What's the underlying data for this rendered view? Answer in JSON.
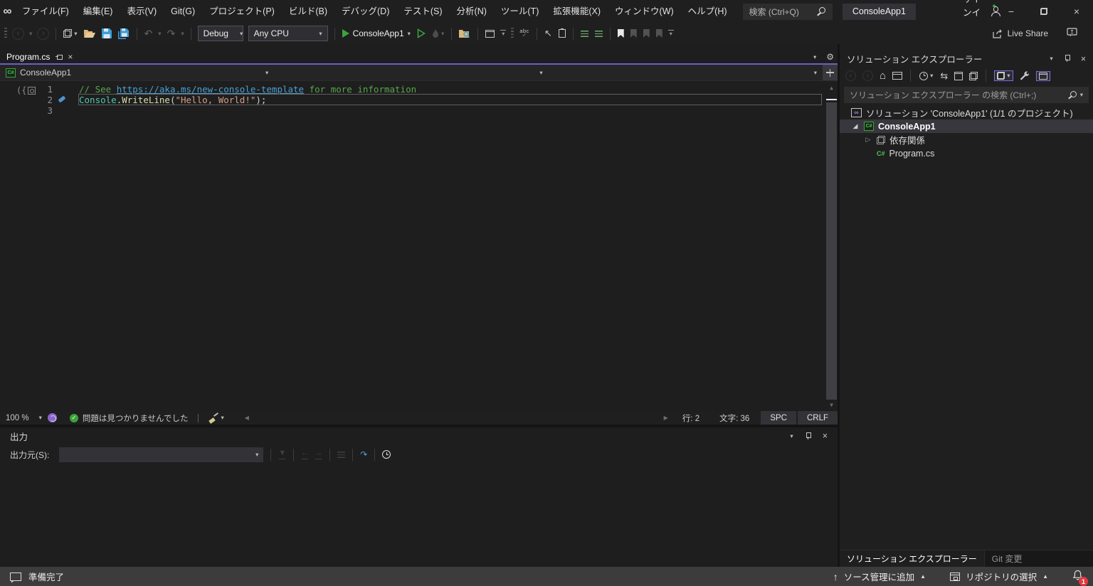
{
  "titlebar": {
    "menus": [
      "ファイル(F)",
      "編集(E)",
      "表示(V)",
      "Git(G)",
      "プロジェクト(P)",
      "ビルド(B)",
      "デバッグ(D)",
      "テスト(S)",
      "分析(N)",
      "ツール(T)",
      "拡張機能(X)",
      "ウィンドウ(W)",
      "ヘルプ(H)"
    ],
    "search_placeholder": "検索 (Ctrl+Q)",
    "project_chip": "ConsoleApp1",
    "signin_label": "サインイン"
  },
  "toolbar": {
    "config": "Debug",
    "platform": "Any CPU",
    "run_target": "ConsoleApp1",
    "live_share_label": "Live Share"
  },
  "editor": {
    "tab_title": "Program.cs",
    "breadcrumb_project": "ConsoleApp1",
    "line_numbers": [
      "1",
      "2",
      "3"
    ],
    "outline_glyph": "({",
    "code": {
      "l1_comment_pre": "// See ",
      "l1_link": "https://aka.ms/new-console-template",
      "l1_comment_post": " for more information",
      "l2_class": "Console",
      "l2_dot": ".",
      "l2_method": "WriteLine",
      "l2_paren_open": "(",
      "l2_string": "\"Hello, World!\"",
      "l2_paren_close": ");"
    },
    "statusbar": {
      "zoom": "100 %",
      "health": "問題は見つかりませんでした",
      "line": "行: 2",
      "column": "文字: 36",
      "space_mode": "SPC",
      "eol": "CRLF"
    }
  },
  "output_panel": {
    "title": "出力",
    "source_label": "出力元(S):"
  },
  "solution_explorer": {
    "title": "ソリューション エクスプローラー",
    "search_placeholder": "ソリューション エクスプローラー の検索 (Ctrl+;)",
    "solution_node": "ソリューション 'ConsoleApp1' (1/1 のプロジェクト)",
    "project_node": "ConsoleApp1",
    "dependencies_node": "依存関係",
    "file_node": "Program.cs",
    "tab_solution": "ソリューション エクスプローラー",
    "tab_git": "Git 変更"
  },
  "statusbar": {
    "ready": "準備完了",
    "add_to_source_control": "ソース管理に追加",
    "select_repository": "リポジトリの選択",
    "notification_count": "1"
  },
  "icons": {
    "vs_logo": "∞",
    "dropdown": "▾",
    "close": "×",
    "minimize": "−",
    "home": "⌂",
    "gear": "⚙",
    "undo": "↶",
    "redo": "↷",
    "sync": "⇆",
    "solution_infinity": "∞",
    "expanded": "◢",
    "collapsed": "▷",
    "up_arrow": "↑",
    "scroll_left": "◀",
    "scroll_right": "▶",
    "scroll_up": "▲",
    "scroll_down": "▼",
    "prev": "←",
    "next": "→",
    "check": "✓",
    "nav_back": "‹",
    "nav_forward": "›",
    "cursor": "↖",
    "cs_badge": "C#"
  },
  "colors": {
    "accent_purple": "#6c5fc7",
    "run_green": "#3ca33c",
    "save_blue": "#3f9bd8",
    "comment_green": "#57A64A",
    "link_blue": "#4e9fd0",
    "type_teal": "#4EC9B0",
    "method_yellow": "#DCDCAA",
    "string_orange": "#D69D85",
    "badge_red": "#e5383f"
  }
}
